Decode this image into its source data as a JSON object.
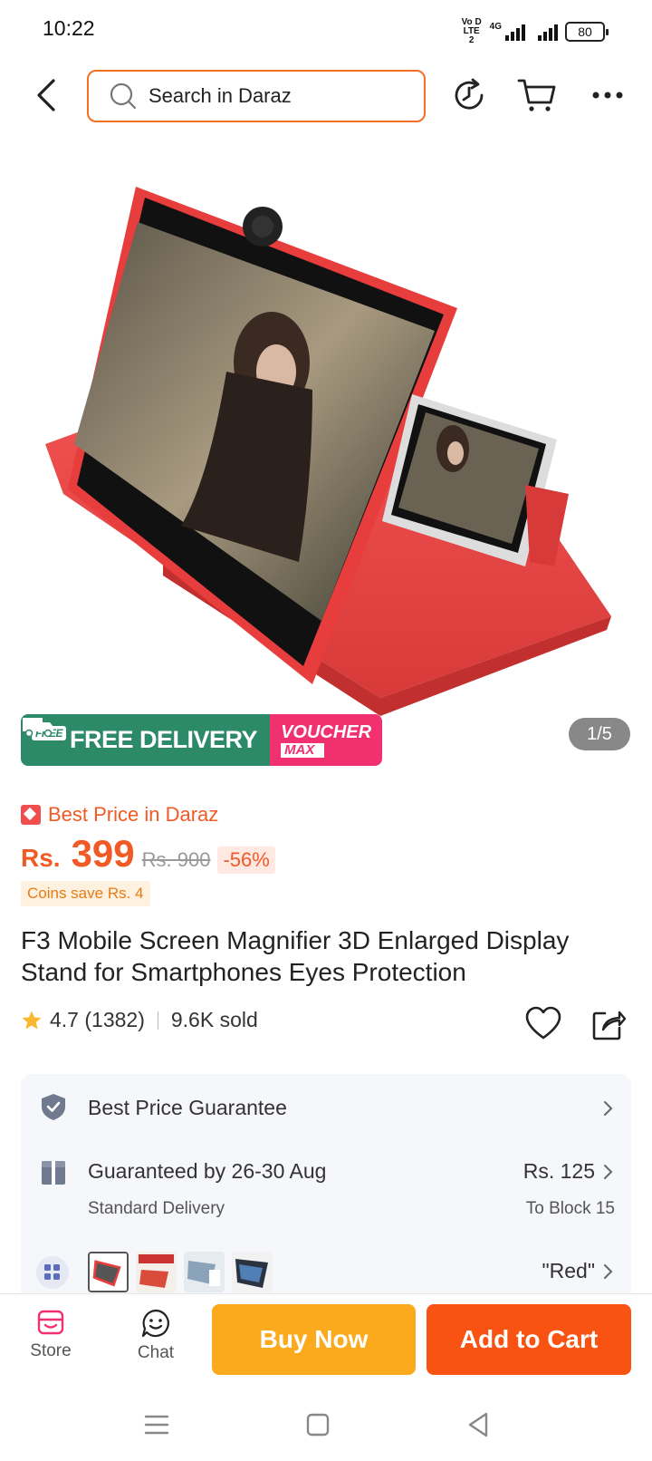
{
  "status_bar": {
    "time": "10:22",
    "volte_label": "Vo D LTE 2",
    "network_label": "4G",
    "battery": "80"
  },
  "top_nav": {
    "search_placeholder": "Search in Daraz",
    "icons": [
      "back-icon",
      "search-icon",
      "history-icon",
      "cart-icon",
      "more-icon"
    ]
  },
  "hero": {
    "promo_free": "FREE DELIVERY",
    "promo_free_tag": "FREE",
    "promo_voucher_line1": "VOUCHER",
    "promo_voucher_line2": "MAX",
    "page_indicator": "1/5"
  },
  "product": {
    "best_price_label": "Best Price in Daraz",
    "currency": "Rs.",
    "price": "399",
    "original_price": "Rs. 900",
    "discount": "-56%",
    "coins": "Coins save Rs. 4",
    "title": "F3 Mobile Screen Magnifier 3D Enlarged Display Stand for Smartphones Eyes Protection",
    "rating": "4.7 (1382)",
    "sold": "9.6K sold"
  },
  "info_card": {
    "guarantee_label": "Best Price Guarantee",
    "delivery_label": "Guaranteed by 26-30 Aug",
    "delivery_sub": "Standard Delivery",
    "delivery_fee": "Rs. 125",
    "delivery_to": "To Block 15",
    "variant_value": "\"Red\""
  },
  "bottom_bar": {
    "store_label": "Store",
    "chat_label": "Chat",
    "buy_now_label": "Buy Now",
    "add_cart_label": "Add to Cart"
  },
  "colors": {
    "brand_orange": "#f85312",
    "buy_now_yellow": "#fbaa1e",
    "free_delivery_green": "#2c8a68",
    "voucher_pink": "#f0306f"
  }
}
